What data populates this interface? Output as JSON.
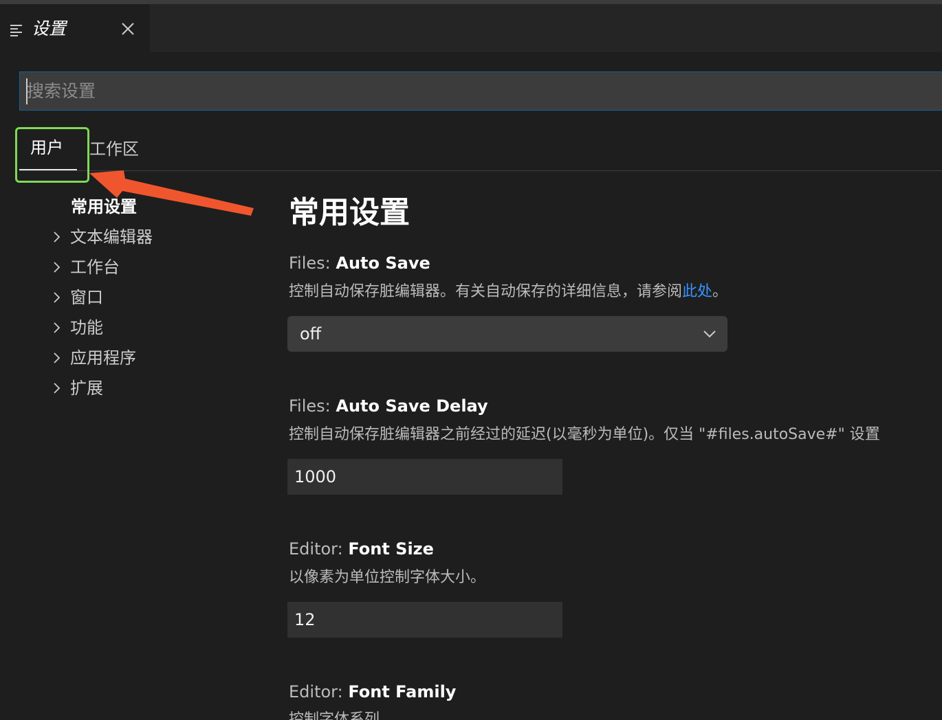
{
  "tab": {
    "title": "设置",
    "icon": "settings-list-icon",
    "close_icon": "close-icon"
  },
  "search": {
    "placeholder": "搜索设置",
    "value": ""
  },
  "scopes": {
    "user": "用户",
    "workspace": "工作区",
    "active": "用户"
  },
  "toc": {
    "active": "常用设置",
    "items": [
      {
        "label": "文本编辑器"
      },
      {
        "label": "工作台"
      },
      {
        "label": "窗口"
      },
      {
        "label": "功能"
      },
      {
        "label": "应用程序"
      },
      {
        "label": "扩展"
      }
    ]
  },
  "content": {
    "section_title": "常用设置",
    "settings": [
      {
        "category": "Files: ",
        "name": "Auto Save",
        "description": "控制自动保存脏编辑器。有关自动保存的详细信息，请参阅",
        "link_text": "此处",
        "description_suffix": "。",
        "value": "off"
      },
      {
        "category": "Files: ",
        "name": "Auto Save Delay",
        "description": "控制自动保存脏编辑器之前经过的延迟(以毫秒为单位)。仅当 \"#files.autoSave#\" 设置",
        "value": "1000"
      },
      {
        "category": "Editor: ",
        "name": "Font Size",
        "description": "以像素为单位控制字体大小。",
        "value": "12"
      },
      {
        "category": "Editor: ",
        "name": "Font Family",
        "description": "控制字体系列。"
      }
    ]
  },
  "colors": {
    "background": "#1e1e1e",
    "accent_link": "#3794ff",
    "highlight_box": "#7ed957",
    "arrow": "#f0562e",
    "input_border": "#0e639c"
  }
}
